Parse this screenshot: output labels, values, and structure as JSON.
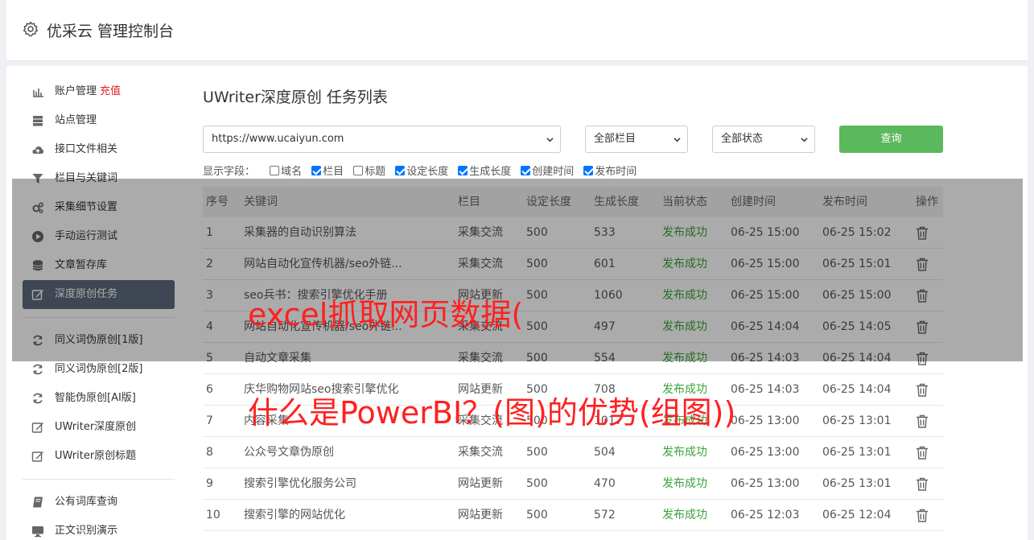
{
  "app": {
    "title": "优采云 管理控制台"
  },
  "sidebar": {
    "items": [
      {
        "label": "账户管理",
        "badge": "充值",
        "icon": "bar-chart-icon"
      },
      {
        "label": "站点管理",
        "icon": "server-icon"
      },
      {
        "label": "接口文件相关",
        "icon": "cloud-upload-icon"
      },
      {
        "label": "栏目与关键词",
        "icon": "filter-icon"
      },
      {
        "label": "采集细节设置",
        "icon": "gears-icon"
      },
      {
        "label": "手动运行测试",
        "icon": "play-icon"
      },
      {
        "label": "文章暂存库",
        "icon": "database-icon"
      },
      {
        "label": "深度原创任务",
        "icon": "edit-icon"
      }
    ],
    "items2": [
      {
        "label": "同义词伪原创[1版]",
        "icon": "refresh-icon"
      },
      {
        "label": "同义词伪原创[2版]",
        "icon": "refresh-icon"
      },
      {
        "label": "智能伪原创[AI版]",
        "icon": "refresh-icon"
      },
      {
        "label": "UWriter深度原创",
        "icon": "edit-icon"
      },
      {
        "label": "UWriter原创标题",
        "icon": "edit-icon"
      }
    ],
    "items3": [
      {
        "label": "公有词库查询",
        "icon": "book-icon"
      },
      {
        "label": "正文识别演示",
        "icon": "monitor-icon"
      }
    ],
    "active_index": 7
  },
  "main": {
    "title": "UWriter深度原创 任务列表",
    "filters": {
      "site": "https://www.ucaiyun.com",
      "column": "全部栏目",
      "status": "全部状态",
      "query_label": "查询"
    },
    "fields_label": "显示字段：",
    "fields": [
      {
        "label": "域名",
        "checked": false
      },
      {
        "label": "栏目",
        "checked": true
      },
      {
        "label": "标题",
        "checked": false
      },
      {
        "label": "设定长度",
        "checked": true
      },
      {
        "label": "生成长度",
        "checked": true
      },
      {
        "label": "创建时间",
        "checked": true
      },
      {
        "label": "发布时间",
        "checked": true
      }
    ],
    "table": {
      "headers": [
        "序号",
        "关键词",
        "栏目",
        "设定长度",
        "生成长度",
        "当前状态",
        "创建时间",
        "发布时间",
        "操作"
      ],
      "rows": [
        [
          "1",
          "采集器的自动识别算法",
          "采集交流",
          "500",
          "533",
          "发布成功",
          "06-25 15:00",
          "06-25 15:02"
        ],
        [
          "2",
          "网站自动化宣传机器/seo外链...",
          "采集交流",
          "500",
          "601",
          "发布成功",
          "06-25 15:00",
          "06-25 15:01"
        ],
        [
          "3",
          "seo兵书：搜索引擎优化手册",
          "网站更新",
          "500",
          "1060",
          "发布成功",
          "06-25 15:00",
          "06-25 15:00"
        ],
        [
          "4",
          "网站自动化宣传机器/seo外链...",
          "采集交流",
          "500",
          "497",
          "发布成功",
          "06-25 14:04",
          "06-25 14:05"
        ],
        [
          "5",
          "自动文章采集",
          "采集交流",
          "500",
          "554",
          "发布成功",
          "06-25 14:03",
          "06-25 14:04"
        ],
        [
          "6",
          "庆华购物网站seo搜索引擎优化",
          "网站更新",
          "500",
          "708",
          "发布成功",
          "06-25 14:03",
          "06-25 14:04"
        ],
        [
          "7",
          "内容采集",
          "采集交流",
          "500",
          "1017",
          "发布成功",
          "06-25 13:00",
          "06-25 13:01"
        ],
        [
          "8",
          "公众号文章伪原创",
          "采集交流",
          "500",
          "504",
          "发布成功",
          "06-25 13:00",
          "06-25 13:01"
        ],
        [
          "9",
          "搜索引擎优化服务公司",
          "网站更新",
          "500",
          "470",
          "发布成功",
          "06-25 13:00",
          "06-25 13:01"
        ],
        [
          "10",
          "搜索引擎的网站优化",
          "网站更新",
          "500",
          "572",
          "发布成功",
          "06-25 12:03",
          "06-25 12:04"
        ]
      ]
    }
  },
  "watermark": {
    "line1": "excel抓取网页数据(",
    "line2": "什么是PowerBI？(图)的优势(组图))"
  },
  "colors": {
    "accent_green": "#5cb85c",
    "status_green": "#3aa33a",
    "sidebar_active": "#5d6b7d",
    "badge_red": "#e02020",
    "watermark_red": "#ff2020"
  }
}
